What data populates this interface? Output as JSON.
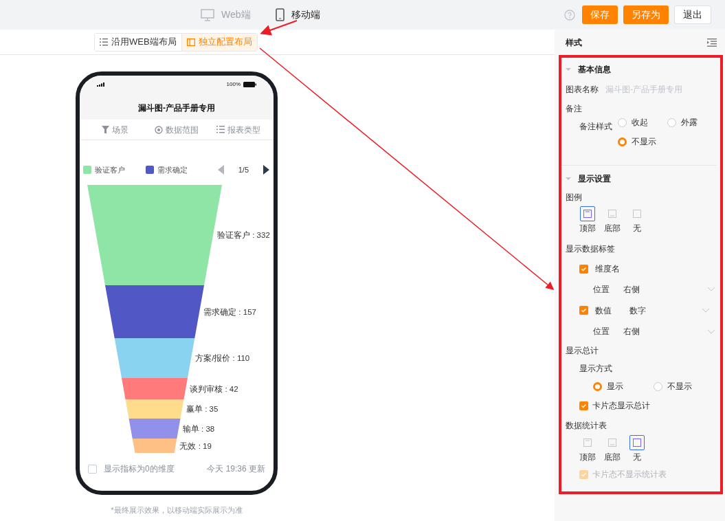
{
  "header": {
    "tabs": [
      {
        "label": "Web端",
        "kind": "desktop",
        "selected": false
      },
      {
        "label": "移动端",
        "kind": "mobile",
        "selected": true
      }
    ],
    "buttons": [
      {
        "label": "保存",
        "kind": "primary"
      },
      {
        "label": "另存为",
        "kind": "primary"
      },
      {
        "label": "退出",
        "kind": "default"
      }
    ]
  },
  "layout_switch": [
    {
      "label": "沿用WEB端布局",
      "kind": "list",
      "selected": false
    },
    {
      "label": "独立配置布局",
      "kind": "panel",
      "selected": true
    }
  ],
  "phone": {
    "battery": "100%",
    "title": "漏斗图-产品手册专用",
    "filters": [
      {
        "label": "场景",
        "kind": "funnel"
      },
      {
        "label": "数据范围",
        "kind": "target"
      },
      {
        "label": "报表类型",
        "kind": "list"
      }
    ],
    "legend": [
      {
        "label": "验证客户",
        "color": "#8ee5a5"
      },
      {
        "label": "需求确定",
        "color": "#5157c4"
      }
    ],
    "page": "1/5",
    "segments": [
      {
        "label": "验证客户 : 332",
        "color": "#8ee5a5"
      },
      {
        "label": "需求确定 : 157",
        "color": "#5157c4"
      },
      {
        "label": "方案/报价 : 110",
        "color": "#8ad3f0"
      },
      {
        "label": "谈判审核 : 42",
        "color": "#ff7b7b"
      },
      {
        "label": "赢单 : 35",
        "color": "#ffdc8c"
      },
      {
        "label": "输单 : 38",
        "color": "#9191ec"
      },
      {
        "label": "无效 : 19",
        "color": "#ffc085"
      }
    ],
    "zero_toggle": {
      "label": "显示指标为0的维度",
      "checked": false
    },
    "updated": "今天 19:36 更新"
  },
  "note": "*最终展示效果，以移动端实际展示为准",
  "panel": {
    "title": "样式",
    "basic": {
      "title": "基本信息",
      "expanded": true,
      "chart_name_label": "图表名称",
      "chart_name_placeholder": "漏斗图-产品手册专用",
      "remark_label": "备注",
      "remark_style_label": "备注样式",
      "remark_options": [
        {
          "label": "收起",
          "selected": false
        },
        {
          "label": "外露",
          "selected": false
        },
        {
          "label": "不显示",
          "selected": true
        }
      ]
    },
    "display": {
      "title": "显示设置",
      "expanded": true,
      "legend_label": "图例",
      "legend_options": [
        {
          "label": "顶部",
          "kind": "top",
          "selected": true
        },
        {
          "label": "底部",
          "kind": "bottom",
          "selected": false
        },
        {
          "label": "无",
          "kind": "none",
          "selected": false
        }
      ],
      "data_labels_label": "显示数据标签",
      "dimension": {
        "label": "维度名",
        "checked": true
      },
      "dimension_position": {
        "label": "位置",
        "value": "右侧"
      },
      "value": {
        "label": "数值",
        "checked": true,
        "format": "数字"
      },
      "value_position": {
        "label": "位置",
        "value": "右侧"
      },
      "total_label": "显示总计",
      "total_mode_label": "显示方式",
      "total_options": [
        {
          "label": "显示",
          "selected": true
        },
        {
          "label": "不显示",
          "selected": false
        }
      ],
      "card_total": {
        "label": "卡片态显示总计",
        "checked": true,
        "disabled": false
      },
      "stats_label": "数据统计表",
      "stats_options": [
        {
          "label": "顶部",
          "kind": "top",
          "selected": false
        },
        {
          "label": "底部",
          "kind": "bottom",
          "selected": false
        },
        {
          "label": "无",
          "kind": "none",
          "selected": true
        }
      ],
      "card_stats": {
        "label": "卡片态不显示统计表",
        "checked": true,
        "disabled": true
      }
    }
  }
}
